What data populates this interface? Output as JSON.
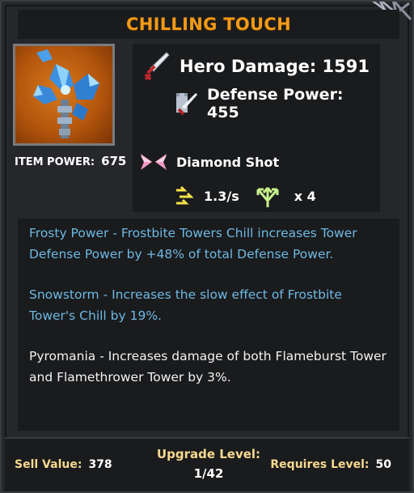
{
  "item": {
    "name": "CHILLING TOUCH",
    "power_label": "ITEM POWER:",
    "power_value": "675",
    "icon": "frost-scepter-icon"
  },
  "stats": {
    "hero_damage": "Hero Damage: 1591",
    "defense_power": "Defense Power: 455",
    "shot_type": "Diamond Shot",
    "attack_speed": "1.3/s",
    "projectiles": "x 4"
  },
  "descriptions": [
    {
      "text": "Frosty Power - Frostbite Towers Chill increases Tower Defense Power by +48% of total Defense Power.",
      "color": "#6eb9e3"
    },
    {
      "text": "Snowstorm - Increases the slow effect of Frostbite Tower's Chill by 19%.",
      "color": "#6eb9e3"
    },
    {
      "text": "Pyromania - Increases damage of both Flameburst Tower and Flamethrower Tower by 3%.",
      "color": "#f2f2f2"
    }
  ],
  "footer": {
    "sell_label": "Sell Value:",
    "sell_value": "378",
    "upgrade_label": "Upgrade Level:",
    "upgrade_value": "1/42",
    "requires_label": "Requires Level:",
    "requires_value": "50"
  },
  "colors": {
    "title": "#f39a16",
    "footer_label": "#f7d98f",
    "ability_text": "#6eb9e3"
  }
}
